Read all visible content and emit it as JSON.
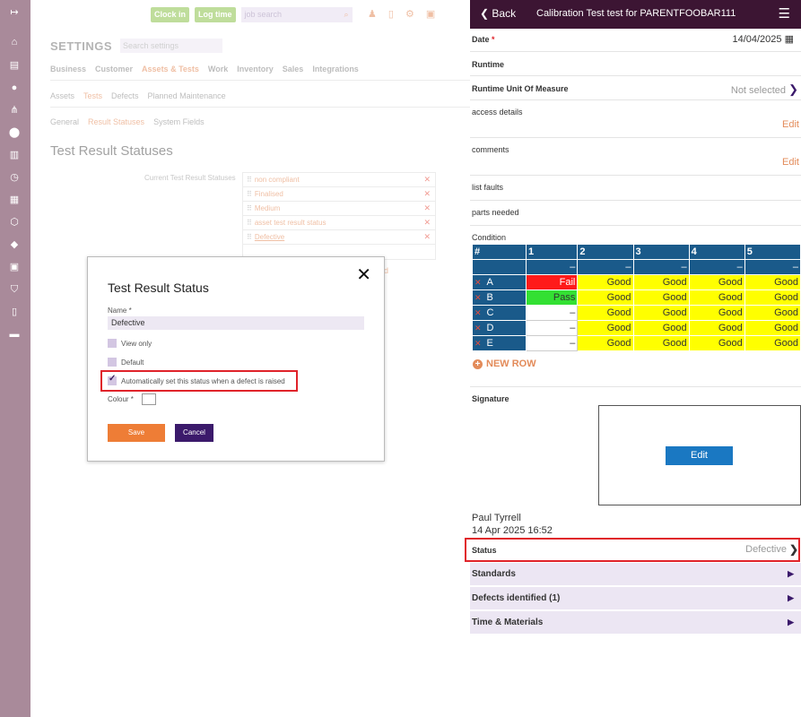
{
  "rail": {
    "icons": [
      "logout-icon",
      "tag-icon",
      "document-icon",
      "user-icon",
      "hierarchy-icon",
      "location-icon",
      "assets-icon",
      "clock-icon",
      "checklist-icon",
      "box-icon",
      "price-tag-icon",
      "scan-icon",
      "shield-icon",
      "book-icon",
      "message-icon"
    ]
  },
  "topbar": {
    "clock_in": "Clock in",
    "log_time": "Log time",
    "job_search_placeholder": "job search"
  },
  "settings": {
    "title": "SETTINGS",
    "search_placeholder": "Search settings",
    "tabs": [
      "Business",
      "Customer",
      "Assets & Tests",
      "Work",
      "Inventory",
      "Sales",
      "Integrations"
    ],
    "subtabs": [
      "Assets",
      "Tests",
      "Defects",
      "Planned Maintenance"
    ],
    "subsubtabs": [
      "General",
      "Result Statuses",
      "System Fields"
    ],
    "page_heading": "Test Result Statuses",
    "current_label": "Current Test Result Statuses",
    "statuses": [
      "non compliant",
      "Finalised",
      "Medium",
      "asset test result status",
      "Defective"
    ],
    "trailing_text": "d"
  },
  "modal": {
    "title": "Test Result Status",
    "name_label": "Name *",
    "name_value": "Defective",
    "view_only": "View only",
    "default": "Default",
    "auto_set": "Automatically set this status when a defect is raised",
    "colour_label": "Colour *",
    "save": "Save",
    "cancel": "Cancel"
  },
  "mobile": {
    "back": "Back",
    "title": "Calibration Test test for PARENTFOOBAR111",
    "date_label": "Date",
    "date_required": "*",
    "date_value": "14/04/2025",
    "runtime_label": "Runtime",
    "runtime_uom_label": "Runtime Unit Of Measure",
    "runtime_uom_value": "Not selected",
    "access_label": "access details",
    "comments_label": "comments",
    "edit": "Edit",
    "list_faults": "list faults",
    "parts_needed": "parts needed",
    "condition_label": "Condition",
    "grid": {
      "headers": [
        "#",
        "1",
        "2",
        "3",
        "4",
        "5"
      ],
      "dash": "–",
      "rows": [
        {
          "name": "A",
          "cells": [
            "Fail",
            "Good",
            "Good",
            "Good",
            "Good"
          ]
        },
        {
          "name": "B",
          "cells": [
            "Pass",
            "Good",
            "Good",
            "Good",
            "Good"
          ]
        },
        {
          "name": "C",
          "cells": [
            "–",
            "Good",
            "Good",
            "Good",
            "Good"
          ]
        },
        {
          "name": "D",
          "cells": [
            "–",
            "Good",
            "Good",
            "Good",
            "Good"
          ]
        },
        {
          "name": "E",
          "cells": [
            "–",
            "Good",
            "Good",
            "Good",
            "Good"
          ]
        }
      ]
    },
    "new_row": "NEW ROW",
    "signature_label": "Signature",
    "signature_edit": "Edit",
    "signer": "Paul Tyrrell",
    "signed_at": "14 Apr 2025 16:52",
    "status_label": "Status",
    "status_value": "Defective",
    "sections": [
      "Standards",
      "Defects identified (1)",
      "Time & Materials"
    ]
  }
}
